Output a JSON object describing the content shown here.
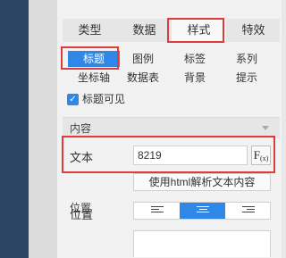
{
  "tabs": [
    {
      "label": "类型"
    },
    {
      "label": "数据"
    },
    {
      "label": "样式"
    },
    {
      "label": "特效"
    }
  ],
  "sub_tabs_row1": [
    {
      "label": "标题"
    },
    {
      "label": "图例"
    },
    {
      "label": "标签"
    },
    {
      "label": "系列"
    }
  ],
  "sub_tabs_row2": [
    {
      "label": "坐标轴"
    },
    {
      "label": "数据表"
    },
    {
      "label": "背景"
    },
    {
      "label": "提示"
    }
  ],
  "title_visible": {
    "label": "标题可见",
    "checked": true
  },
  "content_section": {
    "title": "内容",
    "text_label": "文本",
    "text_value": "8219",
    "fx_label": "F",
    "fx_sub": "(x)",
    "html_button_label": "使用html解析文本内容"
  },
  "position_section": {
    "title": "位置",
    "label": "位置",
    "selected_align": "center"
  },
  "colors": {
    "accent": "#2f87e8",
    "highlight": "#e03b3b",
    "sidebar": "#2e4464"
  }
}
